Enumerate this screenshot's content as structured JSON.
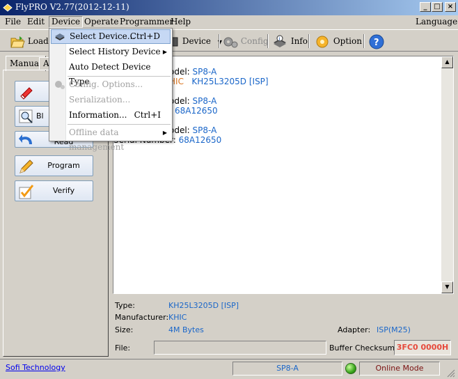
{
  "window": {
    "title": "FlyPRO V2.77(2012-12-11)",
    "min": "_",
    "max": "□",
    "close": "×"
  },
  "menubar": {
    "file": "File",
    "edit": "Edit",
    "device": "Device",
    "operate": "Operate",
    "programmer": "Programmer",
    "help": "Help",
    "language": "Language"
  },
  "toolbar": {
    "load": "Load",
    "device": "Device",
    "config": "Config",
    "info": "Info.",
    "option": "Option"
  },
  "tabs": {
    "manual": "Manual",
    "auto": "Au"
  },
  "ops": {
    "blank": "Bl",
    "read": "Read",
    "program": "Program",
    "verify": "Verify"
  },
  "dropdown": {
    "select_device": "Select Device...",
    "select_device_sc": "Ctrl+D",
    "select_history": "Select History Device",
    "auto_detect": "Auto Detect Device Type",
    "config_options": "Config. Options...",
    "serialization": "Serialization...",
    "information": "Information...",
    "information_sc": "Ctrl+I",
    "offline": "Offline data management"
  },
  "log": {
    "l1a": "odel:",
    "l1b": "SP8-A",
    "l2a": "HIC",
    "l2b": "KH25L3205D [ISP]",
    "l3a": "odel:",
    "l3b": "SP8-A",
    "l4b": "68A12650",
    "l5a": "odel:",
    "l5b": "SP8-A",
    "l6a": "Serial Number:",
    "l6b": "68A12650"
  },
  "info": {
    "type_label": "Type:",
    "type_value": "KH25L3205D [ISP]",
    "mfr_label": "Manufacturer:",
    "mfr_value": "KHIC",
    "size_label": "Size:",
    "size_value": "4M Bytes",
    "adapter_label": "Adapter:",
    "adapter_value": "ISP(M25)",
    "file_label": "File:",
    "checksum_label": "Buffer Checksum:",
    "checksum_value": "3FC0 0000H"
  },
  "status": {
    "company": "Sofi Technology",
    "model": "SP8-A",
    "mode": "Online Mode"
  }
}
